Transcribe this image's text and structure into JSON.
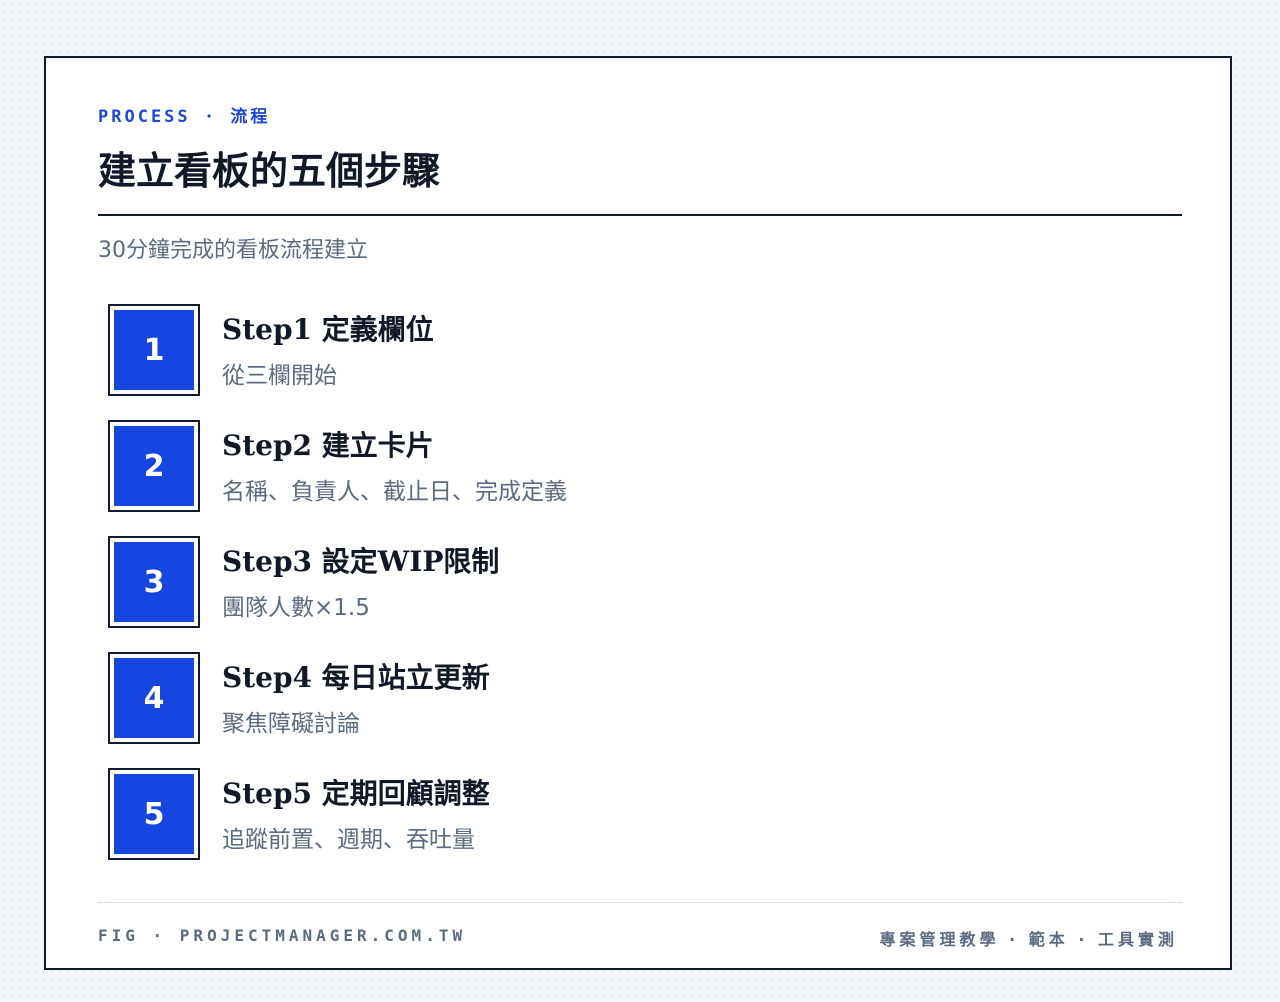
{
  "eyebrow": "PROCESS · 流程",
  "title": "建立看板的五個步驟",
  "subtitle": "30分鐘完成的看板流程建立",
  "steps": [
    {
      "number": "1",
      "title": "Step1 定義欄位",
      "desc": "從三欄開始"
    },
    {
      "number": "2",
      "title": "Step2 建立卡片",
      "desc": "名稱、負責人、截止日、完成定義"
    },
    {
      "number": "3",
      "title": "Step3 設定WIP限制",
      "desc": "團隊人數×1.5"
    },
    {
      "number": "4",
      "title": "Step4 每日站立更新",
      "desc": "聚焦障礙討論"
    },
    {
      "number": "5",
      "title": "Step5 定期回顧調整",
      "desc": "追蹤前置、週期、吞吐量"
    }
  ],
  "footer": {
    "left": "FIG · PROJECTMANAGER.COM.TW",
    "right": "專案管理教學 · 範本 · 工具實測"
  },
  "colors": {
    "accent": "#1745e0",
    "eyebrow": "#1d47d6",
    "ink": "#111827",
    "muted": "#5a6b82"
  }
}
